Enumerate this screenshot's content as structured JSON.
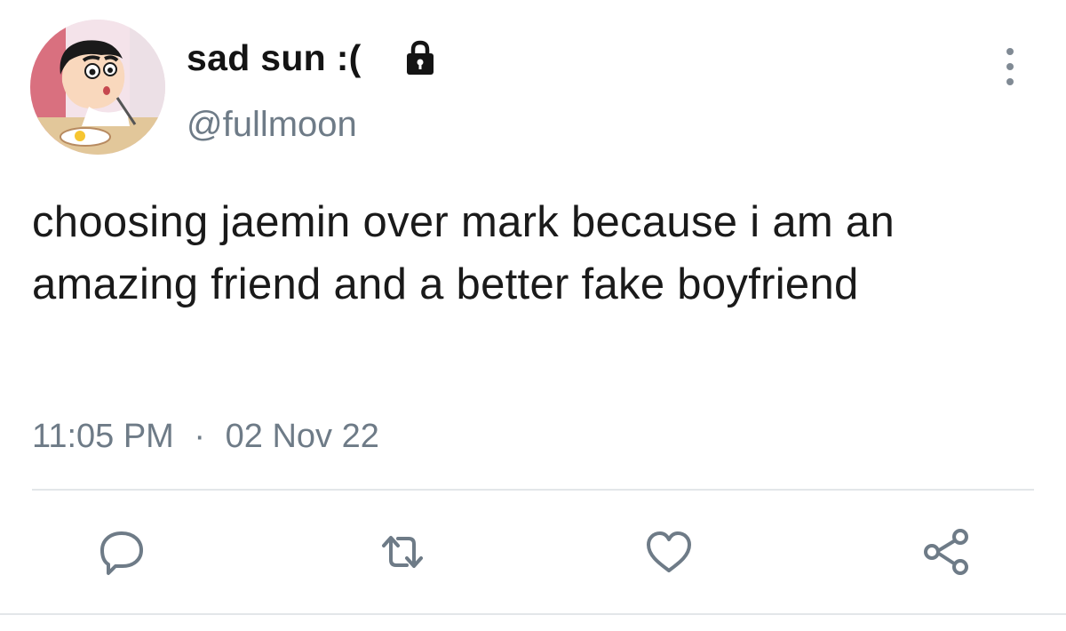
{
  "tweet": {
    "display_name": "sad sun :(",
    "handle": "@fullmoon",
    "text": "choosing jaemin over mark because i am an amazing friend and a better fake boyfriend",
    "time": "11:05 PM",
    "separator": "·",
    "date": "02 Nov 22"
  },
  "icons": {
    "avatar": "cartoon-avatar",
    "protected": "lock-icon",
    "more": "more-vertical-icon",
    "reply": "reply-icon",
    "retweet": "retweet-icon",
    "like": "heart-icon",
    "share": "share-icon"
  },
  "colors": {
    "text": "#1a1a1a",
    "secondary": "#6e7b87",
    "divider": "#e3e6e9",
    "action_icon": "#6e7b87"
  }
}
